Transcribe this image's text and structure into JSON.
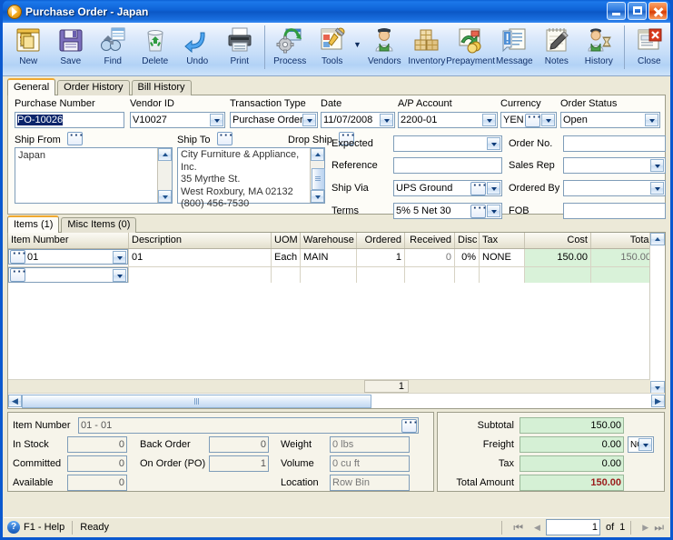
{
  "window": {
    "title": "Purchase Order - Japan",
    "icon": "media-play-orange-icon",
    "minimize": "Minimize",
    "maximize": "Maximize",
    "close": "Close"
  },
  "toolbar": {
    "buttons": [
      {
        "label": "New",
        "icon": "new-document-icon"
      },
      {
        "label": "Save",
        "icon": "floppy-disk-icon"
      },
      {
        "label": "Find",
        "icon": "binoculars-icon"
      },
      {
        "label": "Delete",
        "icon": "recycle-bin-icon"
      },
      {
        "label": "Undo",
        "icon": "undo-arrow-icon"
      },
      {
        "label": "Print",
        "icon": "printer-icon"
      },
      {
        "label": "Process",
        "icon": "gear-refresh-icon"
      },
      {
        "label": "Tools",
        "icon": "tools-icon"
      },
      {
        "label": "Vendors",
        "icon": "vendor-person-icon"
      },
      {
        "label": "Inventory",
        "icon": "boxes-icon"
      },
      {
        "label": "Prepayment",
        "icon": "money-icon"
      },
      {
        "label": "Message",
        "icon": "message-icon"
      },
      {
        "label": "Notes",
        "icon": "notepad-pen-icon"
      },
      {
        "label": "History",
        "icon": "person-hourglass-icon"
      },
      {
        "label": "Close",
        "icon": "close-window-icon"
      }
    ],
    "tools_caret": "▼"
  },
  "tabs": {
    "main": [
      {
        "label": "General",
        "active": true
      },
      {
        "label": "Order History",
        "active": false
      },
      {
        "label": "Bill History",
        "active": false
      }
    ]
  },
  "header_fields": {
    "purchase_number": {
      "label": "Purchase Number",
      "value": "PO-10026"
    },
    "vendor_id": {
      "label": "Vendor ID",
      "value": "V10027"
    },
    "transaction_type": {
      "label": "Transaction Type",
      "value": "Purchase Order"
    },
    "date": {
      "label": "Date",
      "value": "11/07/2008"
    },
    "ap_account": {
      "label": "A/P Account",
      "value": "2200-01"
    },
    "currency": {
      "label": "Currency",
      "value": "YEN"
    },
    "order_status": {
      "label": "Order Status",
      "value": "Open"
    }
  },
  "address": {
    "ship_from_label": "Ship From",
    "ship_from_value": "Japan",
    "ship_to_label": "Ship To",
    "ship_to_value": "City Furniture & Appliance, Inc.\n35 Myrthe St.\nWest Roxbury, MA 02132\n(800) 456-7530",
    "drop_ship_label": "Drop Ship"
  },
  "detail_fields": {
    "expected": {
      "label": "Expected",
      "value": ""
    },
    "reference": {
      "label": "Reference",
      "value": ""
    },
    "ship_via": {
      "label": "Ship Via",
      "value": "UPS Ground"
    },
    "terms": {
      "label": "Terms",
      "value": "5% 5 Net 30"
    },
    "order_no": {
      "label": "Order No.",
      "value": ""
    },
    "sales_rep": {
      "label": "Sales Rep",
      "value": ""
    },
    "ordered_by": {
      "label": "Ordered By",
      "value": ""
    },
    "fob": {
      "label": "FOB",
      "value": ""
    }
  },
  "items_panel": {
    "tabs": [
      {
        "label": "Items (1)",
        "active": true
      },
      {
        "label": "Misc Items (0)",
        "active": false
      }
    ],
    "columns": [
      "Item Number",
      "Description",
      "UOM",
      "Warehouse",
      "Ordered",
      "Received",
      "Disc",
      "Tax",
      "Cost",
      "Total"
    ],
    "rows": [
      {
        "item_number": "01",
        "description": "01",
        "uom": "Each",
        "warehouse": "MAIN",
        "ordered": "1",
        "received": "0",
        "disc": "0%",
        "tax": "NONE",
        "cost": "150.00",
        "total": "150.00"
      },
      {
        "item_number": "",
        "description": "",
        "uom": "",
        "warehouse": "",
        "ordered": "",
        "received": "",
        "disc": "",
        "tax": "",
        "cost": "",
        "total": ""
      }
    ],
    "row_counter": "1"
  },
  "item_detail": {
    "item_number_label": "Item Number",
    "item_number_value": "01 - 01",
    "in_stock": {
      "label": "In Stock",
      "value": "0"
    },
    "committed": {
      "label": "Committed",
      "value": "0"
    },
    "available": {
      "label": "Available",
      "value": "0"
    },
    "back_order": {
      "label": "Back Order",
      "value": "0"
    },
    "on_order": {
      "label": "On Order (PO)",
      "value": "1"
    },
    "weight": {
      "label": "Weight",
      "value": "0 lbs"
    },
    "volume": {
      "label": "Volume",
      "value": "0 cu ft"
    },
    "location": {
      "label": "Location",
      "value": "Row  Bin"
    }
  },
  "totals": {
    "subtotal": {
      "label": "Subtotal",
      "value": "150.00"
    },
    "freight": {
      "label": "Freight",
      "value": "0.00",
      "account": "NO"
    },
    "tax": {
      "label": "Tax",
      "value": "0.00"
    },
    "total_amount": {
      "label": "Total Amount",
      "value": "150.00"
    }
  },
  "statusbar": {
    "help": "F1 - Help",
    "status": "Ready",
    "record_current": "1",
    "record_of": "of",
    "record_total": "1",
    "nav_first": "⏮",
    "nav_prev": "◀",
    "nav_next": "▶",
    "nav_last": "⏭"
  },
  "colors": {
    "accent": "#0b59cf",
    "money_green": "#d5f0d5",
    "total_red": "#9b1c1c",
    "tab_orange": "#f0a930"
  }
}
